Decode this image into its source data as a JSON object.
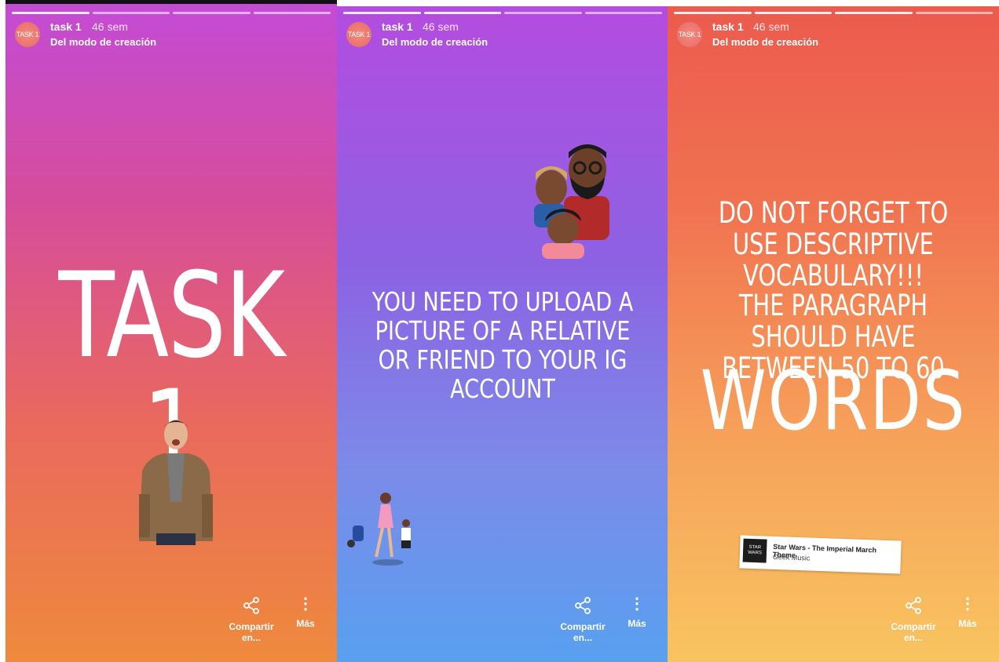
{
  "stories": [
    {
      "username": "task 1",
      "time": "46 sem",
      "subtitle": "Del modo de creación",
      "avatar_text": "TASK 1",
      "headline": "TASK 1",
      "share_label": "Compartir en...",
      "more_label": "Más",
      "sticker": "man-in-brown-jacket"
    },
    {
      "username": "task 1",
      "time": "46 sem",
      "subtitle": "Del modo de creación",
      "avatar_text": "TASK 1",
      "headline": "YOU NEED TO UPLOAD A PICTURE OF A RELATIVE OR FRIEND TO YOUR IG ACCOUNT",
      "share_label": "Compartir en...",
      "more_label": "Más",
      "sticker": "family-emoji"
    },
    {
      "username": "task 1",
      "time": "46 sem",
      "subtitle": "Del modo de creación",
      "avatar_text": "TASK 1",
      "headline_1": "DO NOT FORGET TO USE DESCRIPTIVE VOCABULARY!!!",
      "headline_2": "THE PARAGRAPH SHOULD HAVE BETWEEN 50 TO 60",
      "headline_3": "WORDS",
      "music": {
        "title": "Star Wars - The Imperial March Theme",
        "artist": "Geek Music",
        "cover_text": "STAR WARS"
      },
      "share_label": "Compartir en...",
      "more_label": "Más"
    }
  ],
  "icons": {
    "share": "share-icon",
    "more": "more-vertical-icon"
  },
  "colors": {
    "panel1_top": "#c34bd6",
    "panel1_bottom": "#ee8a3c",
    "panel2_top": "#b54be0",
    "panel2_bottom": "#58a0f0",
    "panel3_top": "#ec5a4e",
    "panel3_bottom": "#f8c460"
  }
}
